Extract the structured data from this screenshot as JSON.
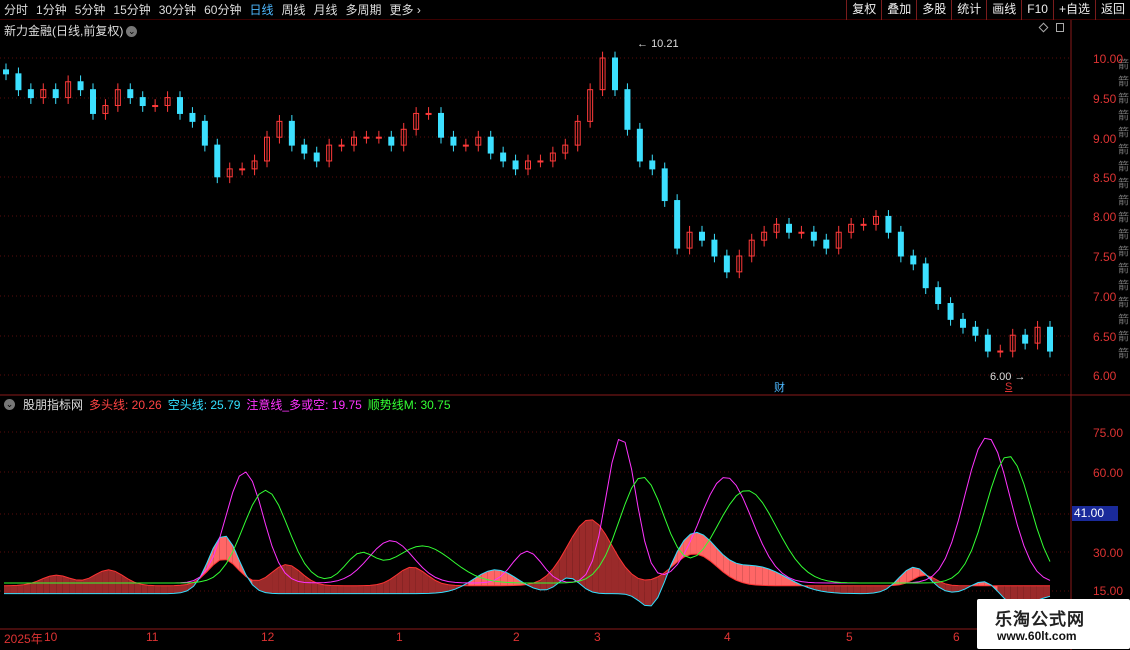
{
  "toolbar": {
    "periods": [
      "分时",
      "1分钟",
      "5分钟",
      "15分钟",
      "30分钟",
      "60分钟",
      "日线",
      "周线",
      "月线",
      "多周期",
      "更多 ›"
    ],
    "active_period": "日线",
    "tools": [
      "复权",
      "叠加",
      "多股",
      "统计",
      "画线",
      "F10",
      "+自选",
      "返回"
    ]
  },
  "stock_title": "新力金融(日线,前复权)",
  "price_axis": [
    "10.00",
    "9.50",
    "9.00",
    "8.50",
    "8.00",
    "7.50",
    "7.00",
    "6.50",
    "6.00"
  ],
  "high_label": "10.21",
  "low_label": "6.00",
  "markers": {
    "finance": "财",
    "s": "S"
  },
  "sidebar_letters": "箭",
  "indicator": {
    "name": "股朋指标网",
    "items": [
      {
        "label": "多头线: 20.26",
        "color": "#ff4444"
      },
      {
        "label": "空头线: 25.79",
        "color": "#33e0ff"
      },
      {
        "label": "注意线_多或空: 19.75",
        "color": "#ff33ff"
      },
      {
        "label": "顺势线M: 30.75",
        "color": "#33ff33"
      }
    ],
    "axis": [
      "75.00",
      "60.00",
      "30.00",
      "15.00"
    ],
    "current_value": "41.00"
  },
  "date_axis": [
    "2025年",
    "10",
    "11",
    "12",
    "1",
    "2",
    "3",
    "4",
    "5",
    "6"
  ],
  "watermark": {
    "title": "乐淘公式网",
    "url": "www.60lt.com"
  },
  "chart_data": {
    "type": "candlestick",
    "title": "新力金融(日线,前复权)",
    "ylim": [
      5.8,
      10.35
    ],
    "close_approx": [
      9.8,
      9.6,
      9.5,
      9.6,
      9.5,
      9.7,
      9.6,
      9.3,
      9.4,
      9.6,
      9.5,
      9.4,
      9.4,
      9.5,
      9.3,
      9.2,
      8.9,
      8.5,
      8.6,
      8.6,
      8.7,
      9.0,
      9.2,
      8.9,
      8.8,
      8.7,
      8.9,
      8.9,
      9.0,
      9.0,
      9.0,
      8.9,
      9.1,
      9.3,
      9.3,
      9.0,
      8.9,
      8.9,
      9.0,
      8.8,
      8.7,
      8.6,
      8.7,
      8.7,
      8.8,
      8.9,
      9.2,
      9.6,
      10.0,
      9.6,
      9.1,
      8.7,
      8.6,
      8.2,
      7.6,
      7.8,
      7.7,
      7.5,
      7.3,
      7.5,
      7.7,
      7.8,
      7.9,
      7.8,
      7.8,
      7.7,
      7.6,
      7.8,
      7.9,
      7.9,
      8.0,
      7.8,
      7.5,
      7.4,
      7.1,
      6.9,
      6.7,
      6.6,
      6.5,
      6.3,
      6.3,
      6.5,
      6.4,
      6.6,
      6.3
    ]
  }
}
